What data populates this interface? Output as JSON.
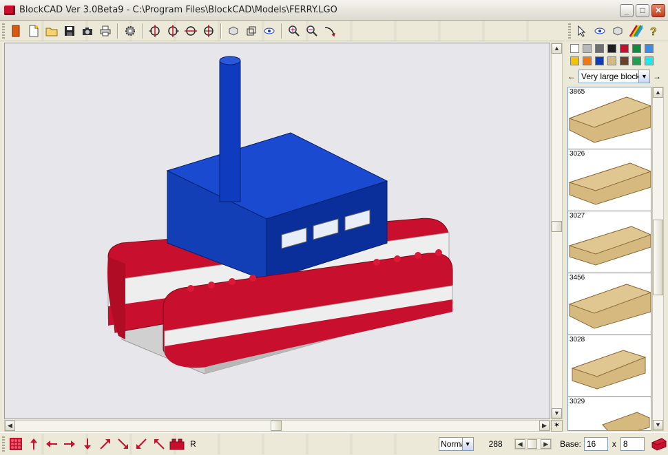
{
  "window": {
    "title": "BlockCAD Ver 3.0Beta9 - C:\\Program Files\\BlockCAD\\Models\\FERRY.LGO",
    "min_label": "_",
    "max_label": "□",
    "close_label": "✕"
  },
  "toolbar_icons": [
    "brick-icon",
    "new-file-icon",
    "open-folder-icon",
    "save-icon",
    "camera-icon",
    "print-icon",
    "settings-gear-icon",
    "rotate-left-icon",
    "rotate-down-icon",
    "rotate-up-icon",
    "rotate-right-icon",
    "view-hidden-icon",
    "view-wireframe-icon",
    "view-eye-icon",
    "zoom-in-icon",
    "zoom-out-icon",
    "rotate-free-icon"
  ],
  "right_toolbar_icons": [
    "select-arrow-icon",
    "eye-icon",
    "hide-icon",
    "rainbow-color-icon",
    "help-icon"
  ],
  "palette": {
    "colors": [
      "#ffffff",
      "#b8b8b8",
      "#6e6e6e",
      "#1e1e1e",
      "#c8102e",
      "#108c3c",
      "#3a8ce8",
      "#f5c400",
      "#f07a10",
      "#0f3cbe",
      "#d6b97e",
      "#6a4026",
      "#20a050",
      "#20e8e8"
    ]
  },
  "category": {
    "selected": "Very large blocks",
    "prev_label": "←",
    "next_label": "→"
  },
  "parts": [
    {
      "id": "3865"
    },
    {
      "id": "3026"
    },
    {
      "id": "3027"
    },
    {
      "id": "3456"
    },
    {
      "id": "3028"
    },
    {
      "id": "3029"
    }
  ],
  "bottom_toolbar": {
    "icons": [
      "grid-snap-icon",
      "move-up-icon",
      "move-left-icon",
      "move-right-icon",
      "move-down-icon",
      "move-ne-icon",
      "move-se-icon",
      "move-sw-icon",
      "move-nw-icon",
      "add-brick-icon"
    ],
    "rotate_label": "R",
    "mode_select": "Norma",
    "piece_count": "288",
    "base_label": "Base:",
    "base_width": "16",
    "base_x_label": "x",
    "base_depth": "8"
  },
  "model": {
    "description_colors": {
      "hull_red": "#c8102e",
      "hull_white": "#f0f0f0",
      "cabin_blue": "#0f3cbe",
      "base_gray": "#d0d0d0"
    }
  }
}
